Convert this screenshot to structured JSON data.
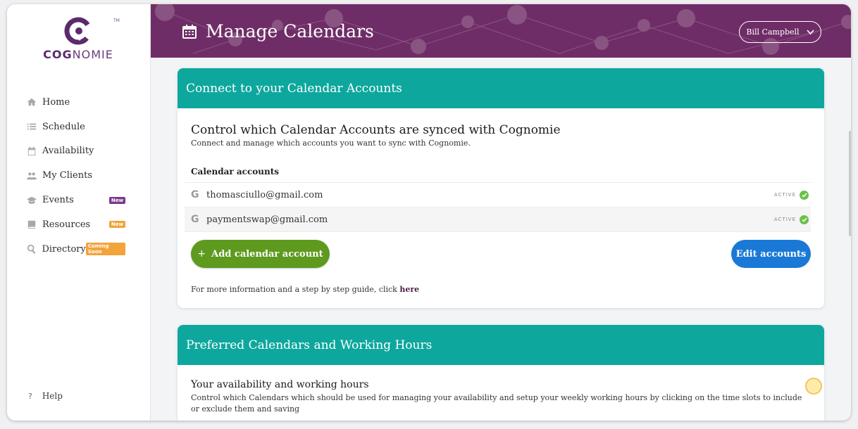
{
  "brand": {
    "logo_bold": "COG",
    "logo_rest": "NOMIE",
    "tm": "TM"
  },
  "sidebar": {
    "items": [
      {
        "label": "Home",
        "icon": "home-icon"
      },
      {
        "label": "Schedule",
        "icon": "list-icon"
      },
      {
        "label": "Availability",
        "icon": "calendar-icon"
      },
      {
        "label": "My Clients",
        "icon": "users-icon"
      },
      {
        "label": "Events",
        "icon": "graduation-cap-icon",
        "badge": "New"
      },
      {
        "label": "Resources",
        "icon": "book-icon",
        "badge": "New"
      },
      {
        "label": "Directory",
        "icon": "search-icon",
        "badge": "Coming Soon"
      }
    ],
    "help": {
      "icon": "?",
      "label": "Help"
    }
  },
  "header": {
    "title": "Manage Calendars",
    "user": "Bill Campbell"
  },
  "connect_card": {
    "header": "Connect to your Calendar Accounts",
    "title": "Control which Calendar Accounts are synced with Cognomie",
    "subtitle": "Connect and manage which accounts you want to sync with Cognomie.",
    "accounts_label": "Calendar accounts",
    "accounts": [
      {
        "provider": "G",
        "email": "thomasciullo@gmail.com",
        "status": "ACTIVE"
      },
      {
        "provider": "G",
        "email": "paymentswap@gmail.com",
        "status": "ACTIVE"
      }
    ],
    "add_button": "Add calendar account",
    "add_icon": "+",
    "edit_button": "Edit accounts",
    "info_text": "For more information and a step by step guide, click ",
    "info_link": "here"
  },
  "preferred_card": {
    "header": "Preferred Calendars and Working Hours",
    "title": "Your availability and working hours",
    "subtitle": "Control which Calendars which should be used for managing your availability and setup your weekly working hours by clicking on the time slots to include or exclude them and saving"
  },
  "colors": {
    "header_purple": "#6f2d67",
    "teal": "#0ea79d",
    "green_button": "#5d9a1e",
    "blue_button": "#1a79d6",
    "badge_purple": "#7b3a8b",
    "badge_orange": "#f2a33a",
    "active_green": "#6cc04a"
  }
}
